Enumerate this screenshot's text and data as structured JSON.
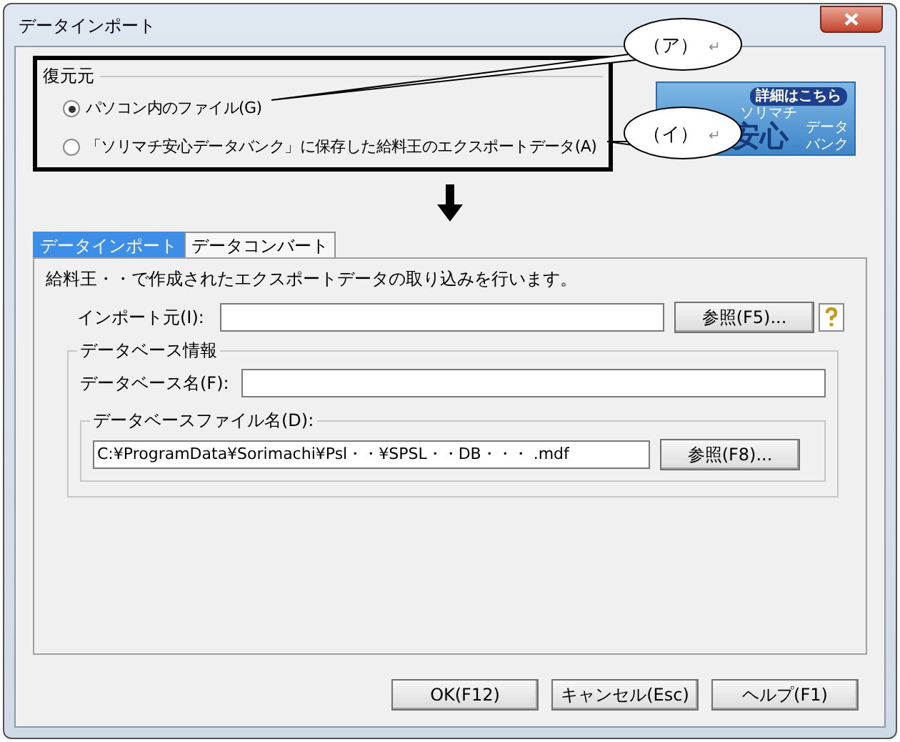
{
  "window": {
    "title": "データインポート"
  },
  "restore_source": {
    "title": "復元元",
    "options": [
      {
        "label": "パソコン内のファイル(G)",
        "selected": true
      },
      {
        "label": "「ソリマチ安心データバンク」に保存した給料王のエクスポートデータ(A)",
        "selected": false
      }
    ]
  },
  "banner": {
    "badge": "詳細はこちら",
    "brand": "ソリマチ",
    "big": "安心",
    "side_top": "データ",
    "side_bottom": "バンク"
  },
  "callouts": [
    {
      "label": "（ア）",
      "mark": "↵"
    },
    {
      "label": "（イ）",
      "mark": "↵"
    }
  ],
  "tabs": [
    {
      "label": "データインポート",
      "selected": true
    },
    {
      "label": "データコンバート",
      "selected": false
    }
  ],
  "description": "給料王・・で作成されたエクスポートデータの取り込みを行います。",
  "import_source": {
    "label": "インポート元(I):",
    "browse": "参照(F5)..."
  },
  "database_info": {
    "title": "データベース情報",
    "name_label": "データベース名(F):",
    "file_group": "データベースファイル名(D):",
    "file_path": "C:¥ProgramData¥Sorimachi¥Psl・・¥SPSL・・DB・・・ .mdf",
    "browse": "参照(F8)..."
  },
  "buttons": [
    {
      "label": "OK(F12)"
    },
    {
      "label": "キャンセル(Esc)"
    },
    {
      "label": "ヘルプ(F1)"
    }
  ]
}
